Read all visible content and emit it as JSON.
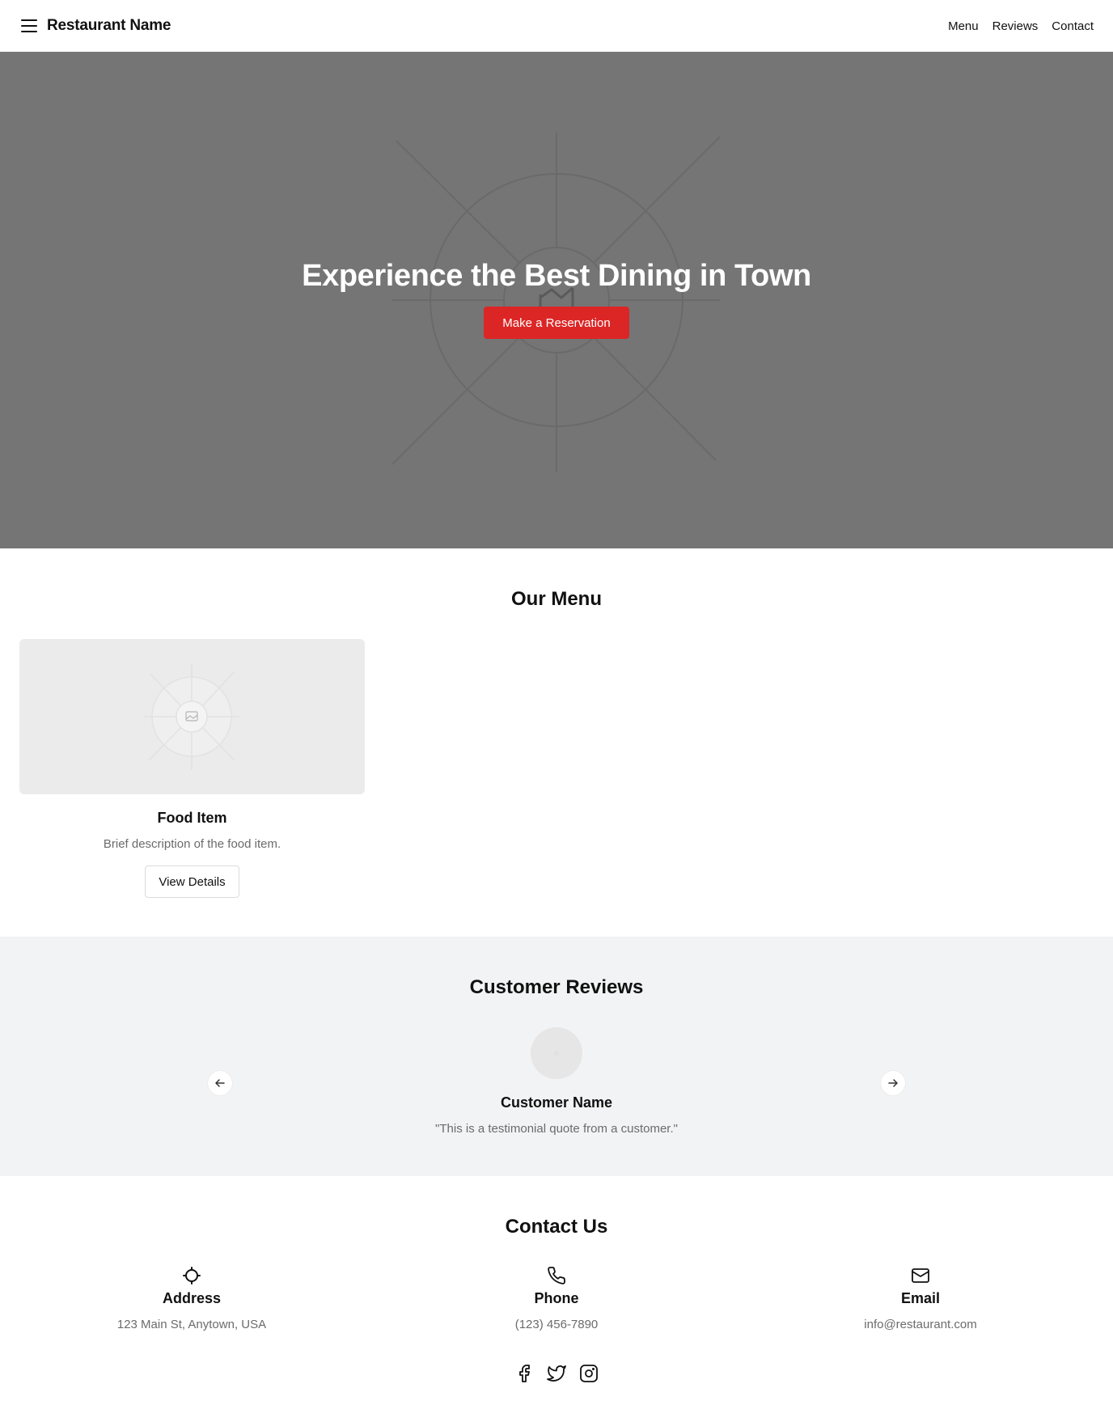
{
  "header": {
    "brand": "Restaurant Name",
    "nav": [
      "Menu",
      "Reviews",
      "Contact"
    ]
  },
  "hero": {
    "title": "Experience the Best Dining in Town",
    "cta": "Make a Reservation",
    "background_color": "#757575",
    "cta_color": "#dc2626"
  },
  "menu": {
    "title": "Our Menu",
    "items": [
      {
        "name": "Food Item",
        "description": "Brief description of the food item.",
        "button": "View Details"
      }
    ]
  },
  "reviews": {
    "title": "Customer Reviews",
    "name": "Customer Name",
    "quote": "\"This is a testimonial quote from a customer.\"",
    "background_color": "#f2f3f4"
  },
  "contact": {
    "title": "Contact Us",
    "items": [
      {
        "icon": "location-icon",
        "label": "Address",
        "value": "123 Main St, Anytown, USA"
      },
      {
        "icon": "phone-icon",
        "label": "Phone",
        "value": "(123) 456-7890"
      },
      {
        "icon": "mail-icon",
        "label": "Email",
        "value": "info@restaurant.com"
      }
    ],
    "socials": [
      "facebook-icon",
      "twitter-icon",
      "instagram-icon"
    ]
  }
}
